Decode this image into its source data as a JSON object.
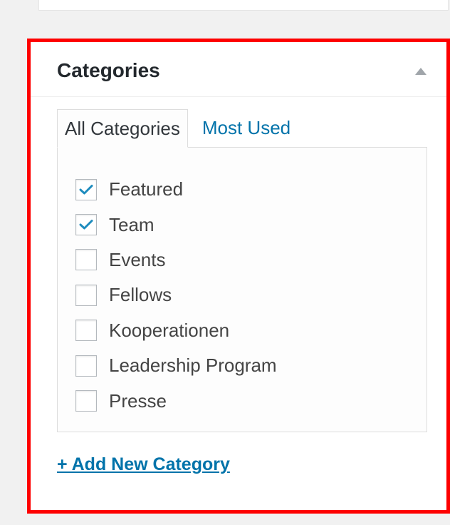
{
  "metabox": {
    "title": "Categories",
    "toggle_icon": "triangle-up-icon"
  },
  "tabs": [
    {
      "label": "All Categories",
      "active": true
    },
    {
      "label": "Most Used",
      "active": false
    }
  ],
  "categories": [
    {
      "label": "Featured",
      "checked": true
    },
    {
      "label": "Team",
      "checked": true
    },
    {
      "label": "Events",
      "checked": false
    },
    {
      "label": "Fellows",
      "checked": false
    },
    {
      "label": "Kooperationen",
      "checked": false
    },
    {
      "label": "Leadership Program",
      "checked": false
    },
    {
      "label": "Presse",
      "checked": false
    }
  ],
  "add_new_label": "+ Add New Category",
  "colors": {
    "highlight_border": "#fe0000",
    "link": "#0073aa",
    "check": "#1e8cbe"
  }
}
